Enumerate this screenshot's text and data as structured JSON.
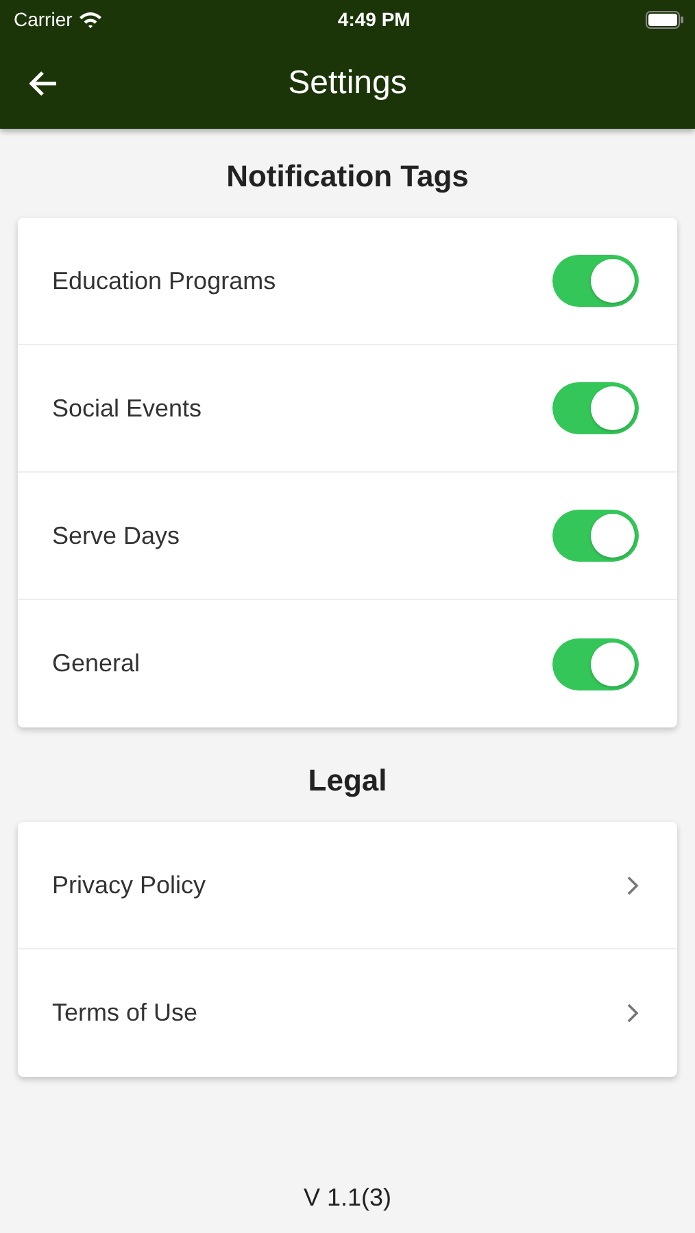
{
  "status_bar": {
    "carrier": "Carrier",
    "time": "4:49 PM"
  },
  "nav_bar": {
    "title": "Settings"
  },
  "sections": [
    {
      "title": "Notification Tags",
      "items": [
        {
          "kind": "toggle",
          "label": "Education Programs",
          "on": true
        },
        {
          "kind": "toggle",
          "label": "Social Events",
          "on": true
        },
        {
          "kind": "toggle",
          "label": "Serve Days",
          "on": true
        },
        {
          "kind": "toggle",
          "label": "General",
          "on": true
        }
      ]
    },
    {
      "title": "Legal",
      "items": [
        {
          "kind": "link",
          "label": "Privacy Policy"
        },
        {
          "kind": "link",
          "label": "Terms of Use"
        }
      ]
    }
  ],
  "version": "V 1.1(3)"
}
